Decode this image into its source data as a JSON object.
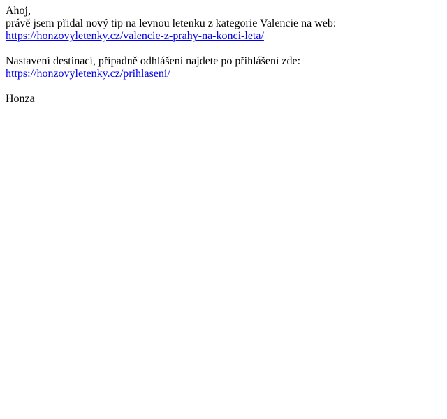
{
  "email": {
    "greeting": "Ahoj,",
    "intro": "právě jsem přidal nový tip na levnou letenku z kategorie Valencie na web:",
    "tip_link": "https://honzovyletenky.cz/valencie-z-prahy-na-konci-leta/",
    "settings_text": "Nastavení destinací, případně odhlášení najdete po přihlášení zde:",
    "login_link": "https://honzovyletenky.cz/prihlaseni/",
    "signature": "Honza"
  },
  "colors": {
    "text": "#000000",
    "link": "#0000ee",
    "background": "#ffffff"
  }
}
